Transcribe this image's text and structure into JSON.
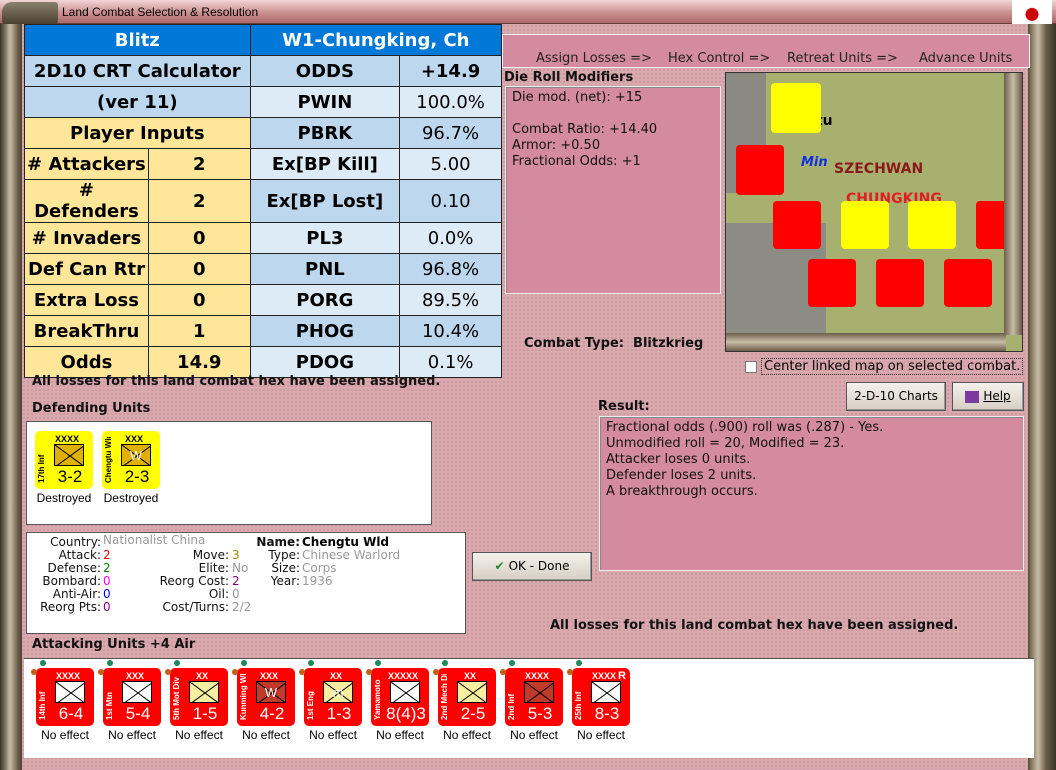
{
  "window": {
    "title": "Land Combat Selection & Resolution"
  },
  "sheet": {
    "header_left": "Blitz",
    "header_right": "W1-Chungking, Ch",
    "calc_title": "2D10 CRT Calculator",
    "calc_version": "(ver 11)",
    "inputs_title": "Player Inputs",
    "inputs": [
      {
        "label": "# Attackers",
        "value": "2"
      },
      {
        "label": "# Defenders",
        "value": "2"
      },
      {
        "label": "# Invaders",
        "value": "0"
      },
      {
        "label": "Def Can Rtr",
        "value": "0"
      },
      {
        "label": "Extra Loss",
        "value": "0"
      },
      {
        "label": "BreakThru",
        "value": "1"
      },
      {
        "label": "Odds",
        "value": "14.9"
      }
    ],
    "outputs": [
      {
        "label": "ODDS",
        "value": "+14.9"
      },
      {
        "label": "PWIN",
        "value": "100.0%"
      },
      {
        "label": "PBRK",
        "value": "96.7%"
      },
      {
        "label": "Ex[BP Kill]",
        "value": "5.00"
      },
      {
        "label": "Ex[BP Lost]",
        "value": "0.10"
      },
      {
        "label": "PL3",
        "value": "0.0%"
      },
      {
        "label": "PNL",
        "value": "96.8%"
      },
      {
        "label": "PORG",
        "value": "89.5%"
      },
      {
        "label": "PHOG",
        "value": "10.4%"
      },
      {
        "label": "PDOG",
        "value": "0.1%"
      }
    ]
  },
  "phases": [
    "Assign Losses =>",
    "Hex Control =>",
    "Retreat Units =>",
    "Advance Units"
  ],
  "die_roll": {
    "title": "Die Roll Modifiers",
    "lines": [
      "Die mod. (net): +15",
      "",
      "Combat Ratio: +14.40",
      "Armor: +0.50",
      "Fractional Odds: +1"
    ]
  },
  "combat_type": {
    "label": "Combat Type:",
    "value": "Blitzkrieg"
  },
  "map": {
    "labels": {
      "city": "ngtu",
      "river": "Min",
      "region": "SZECHWAN",
      "hex": "CHUNGKING"
    }
  },
  "center_linked": {
    "label": "Center linked map on selected combat.",
    "checked": false
  },
  "buttons": {
    "charts": "2-D-10 Charts",
    "help": "Help",
    "ok": "OK - Done"
  },
  "status_top": "All losses for this land combat hex have been assigned.",
  "status_bottom": "All losses for this land combat hex have been assigned.",
  "defending": {
    "title": "Defending Units",
    "units": [
      {
        "name": "17th Inf",
        "size": "XXXX",
        "strength": "3-2",
        "color": "#ffff00",
        "sym": "#e0b000",
        "mark": "",
        "result": "Destroyed"
      },
      {
        "name": "Chengtu Wld",
        "size": "XXX",
        "strength": "2-3",
        "color": "#ffff00",
        "sym": "#e0b000",
        "mark": "W",
        "result": "Destroyed"
      }
    ]
  },
  "result": {
    "title": "Result:",
    "lines": [
      "Fractional odds (.900) roll was (.287)  - Yes.",
      "Unmodified roll = 20, Modified = 23.",
      "Attacker loses 0 units.",
      "Defender loses 2 units.",
      "A breakthrough occurs."
    ]
  },
  "unit_info": {
    "country": {
      "label": "Country:",
      "value": "Nationalist China"
    },
    "attack": {
      "label": "Attack:",
      "value": "2"
    },
    "defense": {
      "label": "Defense:",
      "value": "2"
    },
    "bombard": {
      "label": "Bombard:",
      "value": "0"
    },
    "anti_air": {
      "label": "Anti-Air:",
      "value": "0"
    },
    "reorg_pts": {
      "label": "Reorg Pts:",
      "value": "0"
    },
    "move": {
      "label": "Move:",
      "value": "3"
    },
    "elite": {
      "label": "Elite:",
      "value": "No"
    },
    "reorg_cost": {
      "label": "Reorg Cost:",
      "value": "2"
    },
    "oil": {
      "label": "Oil:",
      "value": "0"
    },
    "cost_turns": {
      "label": "Cost/Turns:",
      "value": "2/2"
    },
    "name": {
      "label": "Name:",
      "value": "Chengtu Wld"
    },
    "type": {
      "label": "Type:",
      "value": "Chinese Warlord"
    },
    "size": {
      "label": "Size:",
      "value": "Corps"
    },
    "year": {
      "label": "Year:",
      "value": "1936"
    }
  },
  "attacking": {
    "title": "Attacking Units +4 Air",
    "units": [
      {
        "name": "14th Inf",
        "size": "XXXX",
        "strength": "6-4",
        "color": "#ff0000",
        "sym": "#ffffff",
        "mark": "",
        "result": "No effect"
      },
      {
        "name": "1st Mtn",
        "size": "XXX",
        "strength": "5-4",
        "color": "#ff0000",
        "sym": "#ffffff",
        "mark": "",
        "result": "No effect"
      },
      {
        "name": "5th Mot Div",
        "size": "XX",
        "strength": "1-5",
        "color": "#ff0000",
        "sym": "#f8f0a0",
        "mark": "",
        "result": "No effect"
      },
      {
        "name": "Kunming Wld",
        "size": "XXX",
        "strength": "4-2",
        "color": "#ff0000",
        "sym": "#c03a2a",
        "mark": "W",
        "result": "No effect"
      },
      {
        "name": "1st Eng",
        "size": "XX",
        "strength": "1-3",
        "color": "#ff0000",
        "sym": "#f8f0a0",
        "mark": "m",
        "result": "No effect"
      },
      {
        "name": "Yamamoto",
        "size": "XXXXX",
        "strength": "8(4)3",
        "color": "#ff0000",
        "sym": "#ffffff",
        "mark": "",
        "result": "No effect"
      },
      {
        "name": "2nd Mech Div",
        "size": "XX",
        "strength": "2-5",
        "color": "#ff0000",
        "sym": "#f8f0a0",
        "mark": "",
        "result": "No effect"
      },
      {
        "name": "2nd Inf",
        "size": "XXXX",
        "strength": "5-3",
        "color": "#ff0000",
        "sym": "#c03a2a",
        "mark": "",
        "result": "No effect"
      },
      {
        "name": "25th Inf",
        "size": "XXXX",
        "strength": "8-3",
        "color": "#ff0000",
        "sym": "#ffffff",
        "mark": "R",
        "result": "No effect"
      }
    ]
  }
}
